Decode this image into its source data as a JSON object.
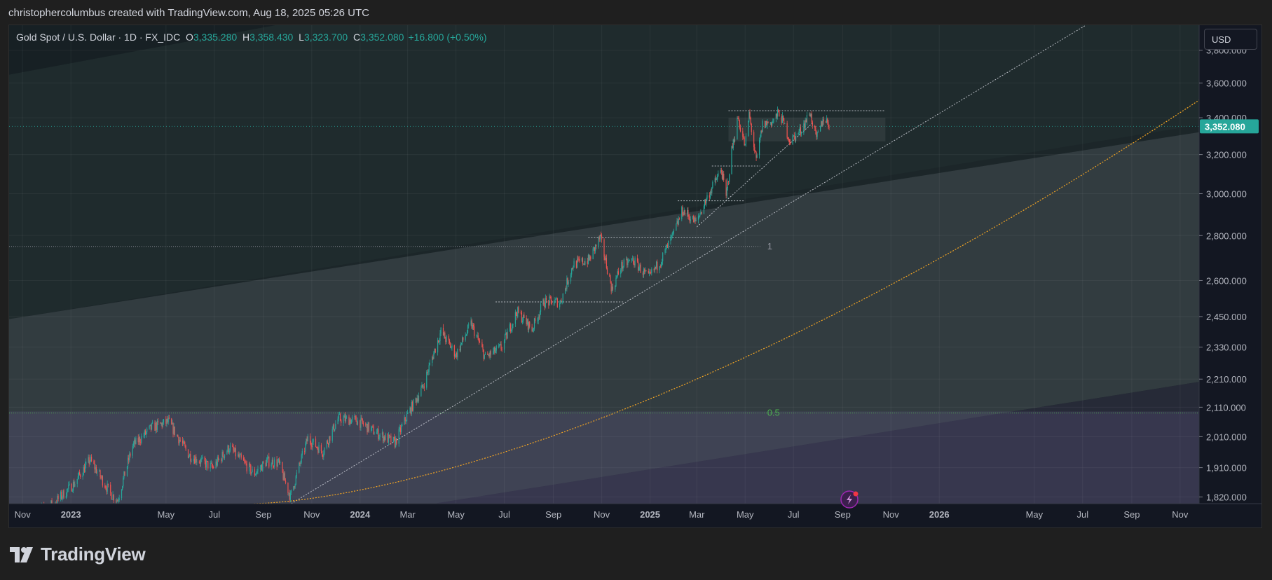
{
  "header": {
    "attribution": "christophercolumbus created with TradingView.com, Aug 18, 2025 05:26 UTC"
  },
  "legend": {
    "symbol": "Gold Spot / U.S. Dollar · 1D · FX_IDC",
    "open_label": "O",
    "open": "3,335.280",
    "high_label": "H",
    "high": "3,358.430",
    "low_label": "L",
    "low": "3,323.700",
    "close_label": "C",
    "close": "3,352.080",
    "change": "+16.800 (+0.50%)"
  },
  "currency_button": "USD",
  "brand": {
    "name": "TradingView"
  },
  "colors": {
    "up": "#26a69a",
    "down": "#ef5350",
    "price_tag": "#26a69a",
    "curve": "#f5a623",
    "fib": "#4caf50"
  },
  "chart_data": {
    "type": "candlestick",
    "symbol": "XAUUSD",
    "interval": "1D",
    "y_scale": "log",
    "ylim": [
      1800,
      3960
    ],
    "y_ticks": [
      "3,800.000",
      "3,600.000",
      "3,400.000",
      "3,200.000",
      "3,000.000",
      "2,800.000",
      "2,600.000",
      "2,450.000",
      "2,330.000",
      "2,210.000",
      "2,110.000",
      "2,010.000",
      "1,910.000",
      "1,820.000"
    ],
    "y_tick_values": [
      3800,
      3600,
      3400,
      3200,
      3000,
      2800,
      2600,
      2450,
      2330,
      2210,
      2110,
      2010,
      1910,
      1820
    ],
    "x_range": [
      "2022-10-15",
      "2025-11-25"
    ],
    "x_ticks": [
      {
        "label": "Nov",
        "date": "2022-11-01",
        "bold": false
      },
      {
        "label": "2023",
        "date": "2023-01-01",
        "bold": true
      },
      {
        "label": "May",
        "date": "2023-05-01",
        "bold": false
      },
      {
        "label": "Jul",
        "date": "2023-07-01",
        "bold": false
      },
      {
        "label": "Sep",
        "date": "2023-09-01",
        "bold": false
      },
      {
        "label": "Nov",
        "date": "2023-11-01",
        "bold": false
      },
      {
        "label": "2024",
        "date": "2024-01-01",
        "bold": true
      },
      {
        "label": "Mar",
        "date": "2024-03-01",
        "bold": false
      },
      {
        "label": "May",
        "date": "2024-05-01",
        "bold": false
      },
      {
        "label": "Jul",
        "date": "2024-07-01",
        "bold": false
      },
      {
        "label": "Sep",
        "date": "2024-09-01",
        "bold": false
      },
      {
        "label": "Nov",
        "date": "2024-11-01",
        "bold": false
      },
      {
        "label": "2025",
        "date": "2025-01-01",
        "bold": true
      },
      {
        "label": "Mar",
        "date": "2025-03-01",
        "bold": false
      },
      {
        "label": "May",
        "date": "2025-05-01",
        "bold": false
      },
      {
        "label": "Jul",
        "date": "2025-07-01",
        "bold": false
      },
      {
        "label": "Sep",
        "date": "2025-09-01",
        "bold": false
      },
      {
        "label": "Nov",
        "date": "2025-11-01",
        "bold": false
      },
      {
        "label": "2026",
        "date": "2026-01-01",
        "bold": true
      },
      {
        "label": "May",
        "date": "2026-05-01",
        "bold": false
      },
      {
        "label": "Jul",
        "date": "2026-07-01",
        "bold": false
      },
      {
        "label": "Sep",
        "date": "2026-09-01",
        "bold": false
      },
      {
        "label": "Nov",
        "date": "2026-11-01",
        "bold": false
      }
    ],
    "x_range_full": [
      "2022-10-15",
      "2026-11-25"
    ],
    "price_path": [
      [
        "2022-11-15",
        1770
      ],
      [
        "2022-12-10",
        1800
      ],
      [
        "2023-01-05",
        1860
      ],
      [
        "2023-01-25",
        1935
      ],
      [
        "2023-02-20",
        1830
      ],
      [
        "2023-03-01",
        1810
      ],
      [
        "2023-03-20",
        1980
      ],
      [
        "2023-04-13",
        2040
      ],
      [
        "2023-05-04",
        2060
      ],
      [
        "2023-05-30",
        1950
      ],
      [
        "2023-06-29",
        1910
      ],
      [
        "2023-07-20",
        1975
      ],
      [
        "2023-08-20",
        1890
      ],
      [
        "2023-09-05",
        1930
      ],
      [
        "2023-09-20",
        1925
      ],
      [
        "2023-10-05",
        1820
      ],
      [
        "2023-10-27",
        2005
      ],
      [
        "2023-11-15",
        1960
      ],
      [
        "2023-12-04",
        2070
      ],
      [
        "2023-12-28",
        2065
      ],
      [
        "2024-01-20",
        2025
      ],
      [
        "2024-02-14",
        1990
      ],
      [
        "2024-03-01",
        2085
      ],
      [
        "2024-03-20",
        2180
      ],
      [
        "2024-04-12",
        2390
      ],
      [
        "2024-05-01",
        2300
      ],
      [
        "2024-05-20",
        2420
      ],
      [
        "2024-06-07",
        2290
      ],
      [
        "2024-06-28",
        2330
      ],
      [
        "2024-07-17",
        2470
      ],
      [
        "2024-08-05",
        2400
      ],
      [
        "2024-08-20",
        2510
      ],
      [
        "2024-09-10",
        2510
      ],
      [
        "2024-09-26",
        2670
      ],
      [
        "2024-10-16",
        2690
      ],
      [
        "2024-10-30",
        2790
      ],
      [
        "2024-11-14",
        2560
      ],
      [
        "2024-11-25",
        2660
      ],
      [
        "2024-12-10",
        2690
      ],
      [
        "2024-12-30",
        2610
      ],
      [
        "2025-01-15",
        2690
      ],
      [
        "2025-01-30",
        2800
      ],
      [
        "2025-02-11",
        2920
      ],
      [
        "2025-02-28",
        2860
      ],
      [
        "2025-03-15",
        2990
      ],
      [
        "2025-04-01",
        3120
      ],
      [
        "2025-04-07",
        2980
      ],
      [
        "2025-04-14",
        3220
      ],
      [
        "2025-04-22",
        3400
      ],
      [
        "2025-05-01",
        3240
      ],
      [
        "2025-05-06",
        3420
      ],
      [
        "2025-05-15",
        3160
      ],
      [
        "2025-05-23",
        3360
      ],
      [
        "2025-06-05",
        3380
      ],
      [
        "2025-06-13",
        3430
      ],
      [
        "2025-06-27",
        3270
      ],
      [
        "2025-07-10",
        3330
      ],
      [
        "2025-07-22",
        3430
      ],
      [
        "2025-07-30",
        3280
      ],
      [
        "2025-08-08",
        3400
      ],
      [
        "2025-08-18",
        3352
      ]
    ],
    "last_price": 3352.08,
    "last_price_label": "3,352.080",
    "fib_levels": [
      {
        "label": "1",
        "price": 2750
      },
      {
        "label": "0.5",
        "price": 2090
      }
    ],
    "support_lines": [
      {
        "price": 2510,
        "from": "2024-06-20",
        "to": "2024-11-28"
      },
      {
        "price": 2790,
        "from": "2024-10-15",
        "to": "2025-03-20"
      },
      {
        "price": 2965,
        "from": "2025-02-05",
        "to": "2025-04-30"
      },
      {
        "price": 3140,
        "from": "2025-03-20",
        "to": "2025-05-20"
      },
      {
        "price": 3440,
        "from": "2025-04-10",
        "to": "2025-10-25"
      }
    ],
    "consolidation_box": {
      "from": "2025-04-10",
      "to": "2025-10-25",
      "top": 3400,
      "bottom": 3270
    },
    "trendlines": [
      {
        "from": [
          "2023-10-06",
          1800
        ],
        "to": [
          "2026-07-05",
          3960
        ]
      },
      {
        "from": [
          "2025-03-01",
          2840
        ],
        "to": [
          "2025-07-25",
          3370
        ]
      }
    ],
    "growth_curve": {
      "from": [
        "2023-08-20",
        1800
      ],
      "to": [
        "2026-11-25",
        3500
      ]
    },
    "parallel_channel": {
      "upper_band": {
        "from": [
          "2022-10-15",
          2440
        ],
        "to": [
          "2026-11-25",
          3320
        ]
      },
      "lower_band": {
        "from": [
          "2022-10-15",
          1610
        ],
        "to": [
          "2026-11-25",
          2200
        ]
      }
    }
  }
}
